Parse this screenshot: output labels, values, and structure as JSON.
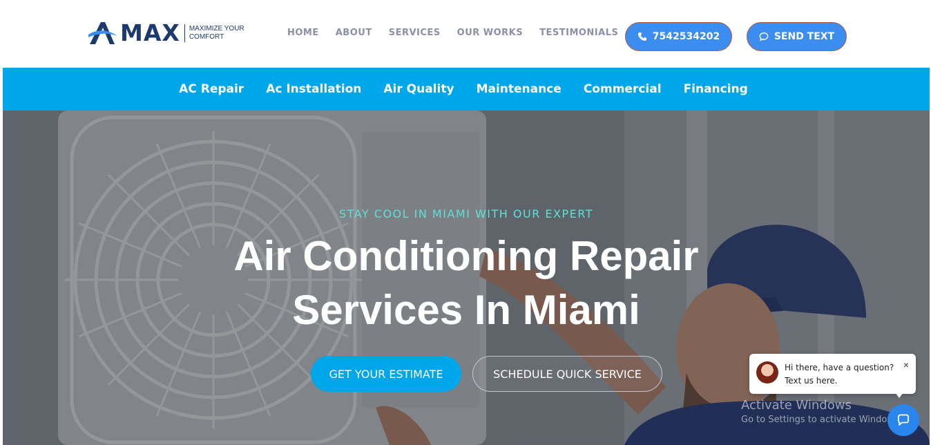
{
  "brand": {
    "logo_text": "MAX",
    "tagline_line1": "MAXIMIZE YOUR",
    "tagline_line2": "COMFORT",
    "primary_color": "#1d3a6e",
    "accent_color": "#00a6ea"
  },
  "nav": {
    "items": [
      "HOME",
      "ABOUT",
      "SERVICES",
      "OUR WORKS",
      "TESTIMONIALS"
    ]
  },
  "header_buttons": {
    "phone_label": "7542534202",
    "phone_icon": "phone-icon",
    "text_label": "SEND TEXT",
    "text_icon": "chat-bubble-icon"
  },
  "service_bar": {
    "items": [
      "AC Repair",
      "Ac Installation",
      "Air Quality",
      "Maintenance",
      "Commercial",
      "Financing"
    ]
  },
  "hero": {
    "eyebrow": "STAY COOL IN MIAMI WITH OUR EXPERT",
    "headline_line1": "Air Conditioning Repair",
    "headline_line2": "Services In Miami",
    "cta_primary": "GET YOUR ESTIMATE",
    "cta_secondary": "SCHEDULE QUICK SERVICE"
  },
  "chat": {
    "line1": "Hi there, have a question?",
    "line2": "Text us here.",
    "close": "×",
    "launcher_icon": "chat-icon"
  },
  "watermark": {
    "title": "Activate Windows",
    "subtitle": "Go to Settings to activate Windows."
  }
}
